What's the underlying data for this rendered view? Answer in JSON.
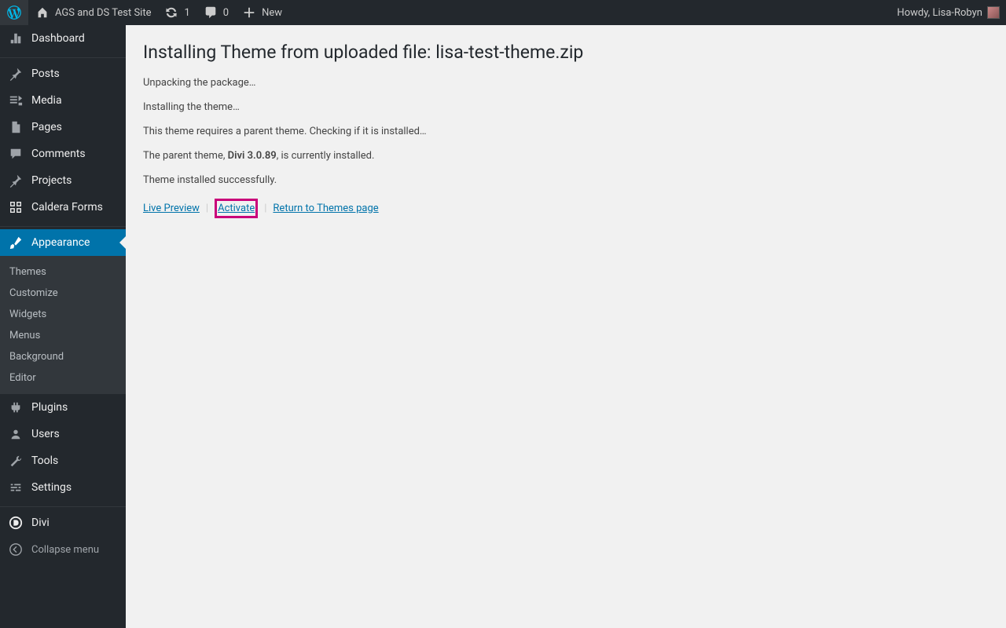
{
  "adminbar": {
    "site_name": "AGS and DS Test Site",
    "updates_count": "1",
    "comments_count": "0",
    "new_label": "New",
    "howdy_prefix": "Howdy, ",
    "user_name": "Lisa-Robyn"
  },
  "sidebar": {
    "items": [
      {
        "id": "dashboard",
        "label": "Dashboard"
      },
      {
        "id": "posts",
        "label": "Posts"
      },
      {
        "id": "media",
        "label": "Media"
      },
      {
        "id": "pages",
        "label": "Pages"
      },
      {
        "id": "comments",
        "label": "Comments"
      },
      {
        "id": "projects",
        "label": "Projects"
      },
      {
        "id": "caldera",
        "label": "Caldera Forms"
      },
      {
        "id": "appearance",
        "label": "Appearance"
      },
      {
        "id": "plugins",
        "label": "Plugins"
      },
      {
        "id": "users",
        "label": "Users"
      },
      {
        "id": "tools",
        "label": "Tools"
      },
      {
        "id": "settings",
        "label": "Settings"
      },
      {
        "id": "divi",
        "label": "Divi"
      }
    ],
    "appearance_submenu": [
      {
        "label": "Themes"
      },
      {
        "label": "Customize"
      },
      {
        "label": "Widgets"
      },
      {
        "label": "Menus"
      },
      {
        "label": "Background"
      },
      {
        "label": "Editor"
      }
    ],
    "collapse_label": "Collapse menu"
  },
  "main": {
    "title_prefix": "Installing Theme from uploaded file: ",
    "title_file": "lisa-test-theme.zip",
    "messages": [
      "Unpacking the package…",
      "Installing the theme…",
      "This theme requires a parent theme. Checking if it is installed…"
    ],
    "parent_msg_prefix": "The parent theme, ",
    "parent_theme_name": "Divi 3.0.89",
    "parent_msg_suffix": ", is currently installed.",
    "success_msg": "Theme installed successfully.",
    "actions": {
      "live_preview": "Live Preview",
      "activate": "Activate",
      "return": "Return to Themes page"
    }
  }
}
